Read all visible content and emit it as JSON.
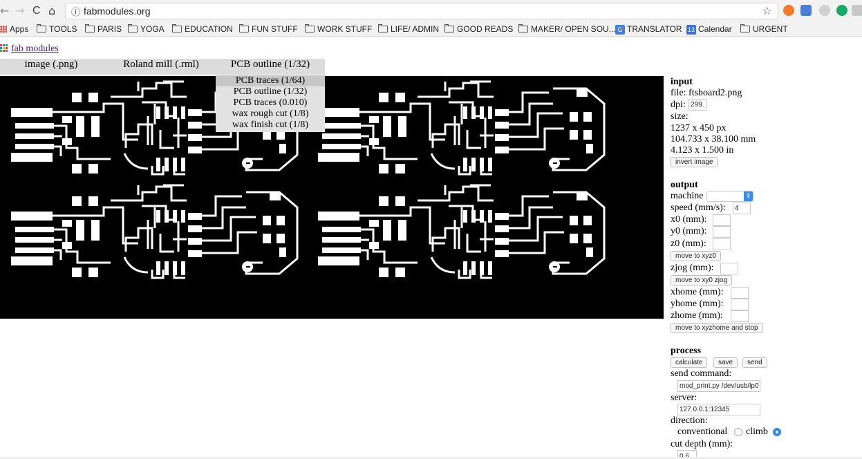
{
  "browser": {
    "url": "fabmodules.org",
    "nav_back": "←",
    "nav_forward": "→",
    "nav_reload": "C",
    "nav_home": "⌂",
    "info_icon": "ⓘ",
    "star_icon": "☆"
  },
  "bookmarks": {
    "apps": "Apps",
    "items": [
      "TOOLS",
      "PARIS",
      "YOGA",
      "EDUCATION",
      "FUN STUFF",
      "WORK STUFF",
      "LIFE/ ADMIN",
      "GOOD READS",
      "MAKER/ OPEN SOU..."
    ],
    "translator": "TRANSLATOR",
    "calendar_badge": "13",
    "calendar": "Calendar",
    "urgent": "URGENT"
  },
  "app": {
    "title": "fab modules",
    "menu": [
      "image (.png)",
      "Roland mill (.rml)",
      "PCB outline (1/32)"
    ],
    "dropdown": {
      "options": [
        "PCB traces (1/64)",
        "PCB outline (1/32)",
        "PCB traces (0.010)",
        "wax rough cut (1/8)",
        "wax finish cut (1/8)"
      ],
      "selected_index": 0
    }
  },
  "input": {
    "heading": "input",
    "file_label": "file: ",
    "file_value": "ftsboard2.png",
    "dpi_label": "dpi:",
    "dpi_value": "299.",
    "size_label": "size:",
    "size_px": "1237 x 450 px",
    "size_mm": "104.733 x 38.100 mm",
    "size_in": "4.123 x 1.500 in",
    "invert_button": "invert image"
  },
  "output": {
    "heading": "output",
    "machine_label": "machine",
    "machine_value": "",
    "speed_label": "speed (mm/s):",
    "speed_value": "4",
    "x0_label": "x0 (mm):",
    "y0_label": "y0 (mm):",
    "z0_label": "z0 (mm):",
    "move_xyz0": "move to xyz0",
    "zjog_label": "zjog (mm):",
    "move_xy0_zjog": "move to xy0 zjog",
    "xhome_label": "xhome (mm):",
    "yhome_label": "yhome (mm):",
    "zhome_label": "zhome (mm):",
    "move_home": "move to xyzhome and stop"
  },
  "process": {
    "heading": "process",
    "calculate": "calculate",
    "save": "save",
    "send": "send",
    "send_command_label": "send command:",
    "send_command_value": "mod_print.py /dev/usb/lp0",
    "server_label": "server:",
    "server_value": "127.0.0.1:12345",
    "direction_label": "direction:",
    "conventional": "conventional",
    "climb": "climb",
    "direction_selected": "climb",
    "cut_depth_label": "cut depth (mm):",
    "cut_depth_value": "0.6"
  },
  "colors": {
    "link": "#551a8b",
    "radio_selected": "#2f8ae8",
    "board_background": "#000000",
    "traces": "#ffffff"
  }
}
